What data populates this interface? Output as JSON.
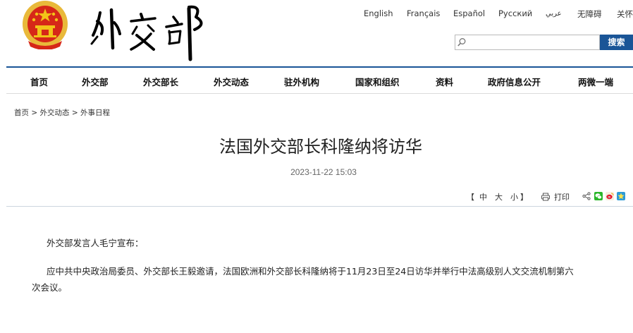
{
  "header": {
    "logo_text": "外交部",
    "emblem": "national-emblem",
    "languages": [
      "English",
      "Français",
      "Español",
      "Русский",
      "عربي",
      "无障碍",
      "关怀"
    ],
    "search": {
      "placeholder": "",
      "button_label": "搜索"
    }
  },
  "nav": {
    "items": [
      "首页",
      "外交部",
      "外交部长",
      "外交动态",
      "驻外机构",
      "国家和组织",
      "资料",
      "政府信息公开",
      "两微一端"
    ]
  },
  "breadcrumb": {
    "items": [
      "首页",
      "外交动态",
      "外事日程"
    ],
    "separator": ">"
  },
  "article": {
    "title": "法国外交部长科隆纳将访华",
    "date": "2023-11-22 15:03",
    "tools": {
      "bracket_open": "【",
      "size_large": "中",
      "size_medium": "大",
      "size_small": "小",
      "bracket_close": "】",
      "print_label": "打印"
    },
    "paragraphs": [
      "外交部发言人毛宁宣布：",
      "应中共中央政治局委员、外交部长王毅邀请，法国欧洲和外交部长科隆纳将于11月23日至24日访华并举行中法高级别人文交流机制第六",
      "次会议。"
    ]
  },
  "colors": {
    "brand_blue": "#1a5597",
    "emblem_red": "#d62718",
    "emblem_gold": "#f2c318"
  }
}
